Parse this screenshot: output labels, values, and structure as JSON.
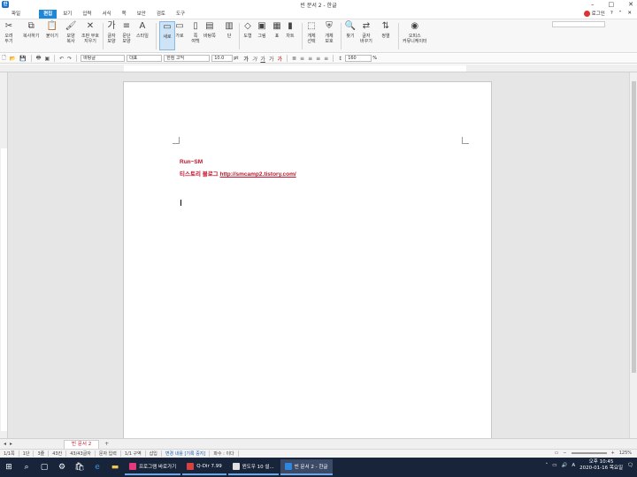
{
  "window": {
    "title": "빈 문서 2 - 한글",
    "app_icon": "한"
  },
  "menubar": {
    "items": [
      "파일",
      "편집",
      "보기",
      "입력",
      "서식",
      "쪽",
      "보안",
      "검토",
      "도구"
    ],
    "active": "편집",
    "login": "로그인"
  },
  "ribbon": {
    "buttons": [
      {
        "label": "오려\n두기",
        "icon": "scissors-icon",
        "glyph": "✂"
      },
      {
        "label": "복사하기",
        "icon": "copy-icon",
        "glyph": "⧉"
      },
      {
        "label": "붙이기",
        "icon": "paste-icon",
        "glyph": "📋"
      },
      {
        "label": "모양\n복사",
        "icon": "format-painter-icon",
        "glyph": "🖌"
      },
      {
        "label": "조판 부호\n지우기",
        "icon": "clear-marks-icon",
        "glyph": "✕"
      },
      {
        "label": "글자\n모양",
        "icon": "char-shape-icon",
        "glyph": "가"
      },
      {
        "label": "문단\n모양",
        "icon": "para-shape-icon",
        "glyph": "≡"
      },
      {
        "label": "스타일",
        "icon": "style-icon",
        "glyph": "A"
      },
      {
        "label": "새로",
        "icon": "new-doc-icon",
        "glyph": "▭"
      },
      {
        "label": "가로",
        "icon": "landscape-icon",
        "glyph": "▭"
      },
      {
        "label": "쪽\n여백",
        "icon": "margin-icon",
        "glyph": "▯"
      },
      {
        "label": "바탕쪽",
        "icon": "master-page-icon",
        "glyph": "▤"
      },
      {
        "label": "단",
        "icon": "columns-icon",
        "glyph": "▥"
      },
      {
        "label": "도형",
        "icon": "shape-icon",
        "glyph": "◇"
      },
      {
        "label": "그림",
        "icon": "picture-icon",
        "glyph": "▣"
      },
      {
        "label": "표",
        "icon": "table-icon",
        "glyph": "▦"
      },
      {
        "label": "차트",
        "icon": "chart-icon",
        "glyph": "▮"
      },
      {
        "label": "개체\n선택",
        "icon": "object-select-icon",
        "glyph": "⬚"
      },
      {
        "label": "개체\n보호",
        "icon": "object-protect-icon",
        "glyph": "⛨"
      },
      {
        "label": "찾기",
        "icon": "find-icon",
        "glyph": "🔍"
      },
      {
        "label": "글자\n바꾸기",
        "icon": "replace-icon",
        "glyph": "⇄"
      },
      {
        "label": "정렬",
        "icon": "sort-icon",
        "glyph": "⇅"
      },
      {
        "label": "오피스\n커뮤니케이터",
        "icon": "communicator-icon",
        "glyph": "◉"
      }
    ],
    "selected": "새로"
  },
  "toolbar2": {
    "style": "바탕글",
    "lang": "대표",
    "font": "한컴 고딕",
    "size": "10.0",
    "size_unit": "pt",
    "zoom": "160",
    "zoom_unit": "%"
  },
  "document": {
    "line1": "Run~SM",
    "line2_prefix": "티스토리 블로그 ",
    "line2_link": "http://smcamp2.tistory.com/"
  },
  "tabs": {
    "doc_tab": "빈 문서 2",
    "add": "+"
  },
  "status": {
    "items": [
      "1/1쪽",
      "1단",
      "3줄",
      "43칸",
      "43/43글자",
      "문자 입력",
      "1/1 구역",
      "삽입",
      "변경 내용 [기록 중지]",
      "파수 : 이다"
    ],
    "zoom": "125%"
  },
  "taskbar": {
    "apps": [
      {
        "label": "프로그램 바로가기",
        "color": "#e23a7a"
      },
      {
        "label": "Q-Dir 7.99",
        "color": "#d94040"
      },
      {
        "label": "윈도우 10 설...",
        "color": "#e0e0e0"
      },
      {
        "label": "빈 문서 2 - 한글",
        "color": "#2e86de"
      }
    ],
    "time": "오후 10:45",
    "date": "2020-01-16 목요일"
  }
}
